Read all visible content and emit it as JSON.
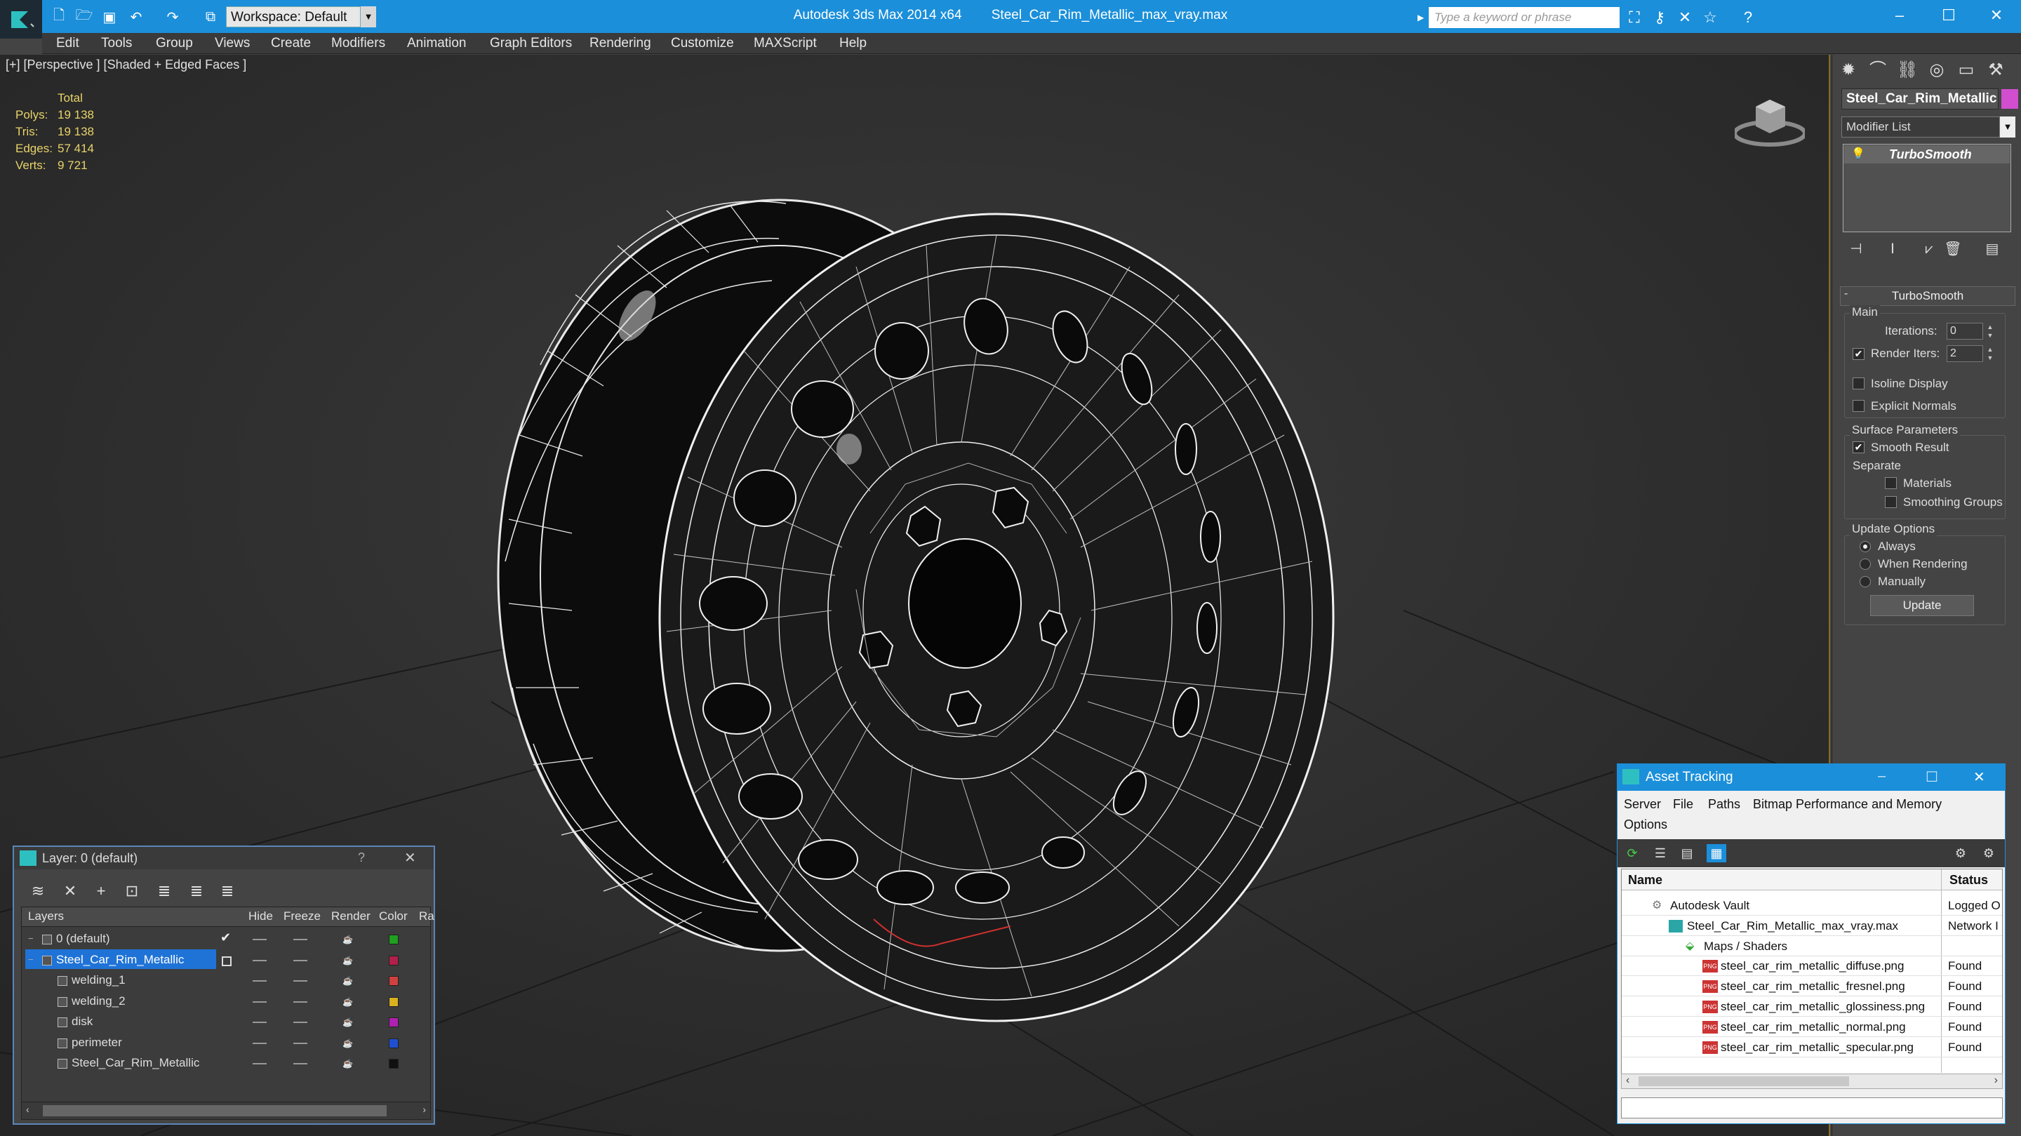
{
  "window": {
    "app_title": "Autodesk 3ds Max  2014 x64",
    "file_title": "Steel_Car_Rim_Metallic_max_vray.max",
    "workspace": "Workspace: Default",
    "search_placeholder": "Type a keyword or phrase"
  },
  "menu": [
    "Edit",
    "Tools",
    "Group",
    "Views",
    "Create",
    "Modifiers",
    "Animation",
    "Graph Editors",
    "Rendering",
    "Customize",
    "MAXScript",
    "Help"
  ],
  "viewport": {
    "label": "[+] [Perspective ] [Shaded + Edged Faces ]",
    "stats": {
      "header": "Total",
      "rows": [
        {
          "label": "Polys:",
          "value": "19 138"
        },
        {
          "label": "Tris:",
          "value": "19 138"
        },
        {
          "label": "Edges:",
          "value": "57 414"
        },
        {
          "label": "Verts:",
          "value": "9 721"
        }
      ]
    }
  },
  "command_panel": {
    "object_name": "Steel_Car_Rim_Metallic",
    "object_color": "#d14ecf",
    "modifier_list": "Modifier List",
    "stack_item": "TurboSmooth",
    "rollout_title": "TurboSmooth",
    "main_group": "Main",
    "iterations_label": "Iterations:",
    "iterations_value": "0",
    "render_iters_label": "Render Iters:",
    "render_iters_value": "2",
    "render_iters_checked": true,
    "isoline_label": "Isoline Display",
    "explicit_label": "Explicit Normals",
    "surface_group": "Surface Parameters",
    "smooth_result_label": "Smooth Result",
    "separate_label": "Separate",
    "materials_label": "Materials",
    "smoothing_label": "Smoothing Groups",
    "update_group": "Update Options",
    "update_always": "Always",
    "update_rendering": "When Rendering",
    "update_manually": "Manually",
    "update_button": "Update"
  },
  "layer_dialog": {
    "title": "Layer: 0 (default)",
    "help": "?",
    "columns": {
      "layers": "Layers",
      "hide": "Hide",
      "freeze": "Freeze",
      "render": "Render",
      "color": "Color",
      "radiosity": "Ra"
    },
    "rows": [
      {
        "name": "0 (default)",
        "color": "#1fa01f",
        "indent": 0,
        "selected": false,
        "active": true
      },
      {
        "name": "Steel_Car_Rim_Metallic",
        "color": "#b0204a",
        "indent": 0,
        "selected": true,
        "active": false
      },
      {
        "name": "welding_1",
        "color": "#d04040",
        "indent": 1,
        "selected": false,
        "active": false
      },
      {
        "name": "welding_2",
        "color": "#d8b020",
        "indent": 1,
        "selected": false,
        "active": false
      },
      {
        "name": "disk",
        "color": "#b020b0",
        "indent": 1,
        "selected": false,
        "active": false
      },
      {
        "name": "perimeter",
        "color": "#2050d0",
        "indent": 1,
        "selected": false,
        "active": false
      },
      {
        "name": "Steel_Car_Rim_Metallic",
        "color": "#101010",
        "indent": 1,
        "selected": false,
        "active": false
      }
    ]
  },
  "asset_tracking": {
    "title": "Asset Tracking",
    "menu": [
      "Server",
      "File",
      "Paths",
      "Bitmap Performance and Memory",
      "Options"
    ],
    "columns": {
      "name": "Name",
      "status": "Status"
    },
    "rows": [
      {
        "name": "Autodesk Vault",
        "status": "Logged O",
        "level": 1,
        "icon": "vault"
      },
      {
        "name": "Steel_Car_Rim_Metallic_max_vray.max",
        "status": "Network I",
        "level": 2,
        "icon": "max"
      },
      {
        "name": "Maps / Shaders",
        "status": "",
        "level": 3,
        "icon": "folder"
      },
      {
        "name": "steel_car_rim_metallic_diffuse.png",
        "status": "Found",
        "level": 4,
        "icon": "png"
      },
      {
        "name": "steel_car_rim_metallic_fresnel.png",
        "status": "Found",
        "level": 4,
        "icon": "png"
      },
      {
        "name": "steel_car_rim_metallic_glossiness.png",
        "status": "Found",
        "level": 4,
        "icon": "png"
      },
      {
        "name": "steel_car_rim_metallic_normal.png",
        "status": "Found",
        "level": 4,
        "icon": "png"
      },
      {
        "name": "steel_car_rim_metallic_specular.png",
        "status": "Found",
        "level": 4,
        "icon": "png"
      }
    ]
  }
}
